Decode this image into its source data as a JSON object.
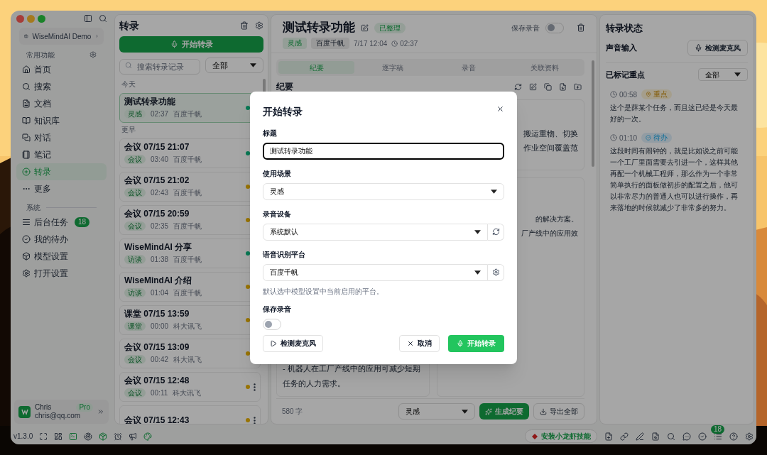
{
  "sidebar": {
    "workspace": "WiseMindAI Demo",
    "sections": [
      {
        "title": "常用功能",
        "items": [
          {
            "label": "首页",
            "selected": false
          },
          {
            "label": "搜索",
            "selected": false
          },
          {
            "label": "文档",
            "selected": false
          },
          {
            "label": "知识库",
            "selected": false
          },
          {
            "label": "对话",
            "selected": false
          },
          {
            "label": "笔记",
            "selected": false
          },
          {
            "label": "转录",
            "selected": true
          },
          {
            "label": "更多",
            "selected": false
          }
        ]
      },
      {
        "title": "系统",
        "items": [
          {
            "label": "后台任务",
            "badge": "18",
            "selected": false
          },
          {
            "label": "我的待办",
            "selected": false
          },
          {
            "label": "模型设置",
            "selected": false
          },
          {
            "label": "打开设置",
            "selected": false
          }
        ]
      }
    ],
    "user": {
      "name": "Chris",
      "badge": "Pro",
      "email": "chris@qq.com"
    }
  },
  "list_panel": {
    "title": "转录",
    "start_button": "开始转录",
    "search": {
      "placeholder": "搜索转录记录"
    },
    "filter": "全部",
    "groups": [
      {
        "title": "今天",
        "items": [
          {
            "title": "测试转录功能",
            "tag": "灵感",
            "duration": "02:37",
            "engine": "百度千帆",
            "color": "#0a7854",
            "selected": true
          }
        ]
      },
      {
        "title": "更早",
        "items": [
          {
            "title": "会议 07/15 21:07",
            "tag": "会议",
            "duration": "03:40",
            "engine": "百度千帆",
            "color": "#0a7854",
            "selected": false
          },
          {
            "title": "会议 07/15 21:02",
            "tag": "会议",
            "duration": "02:43",
            "engine": "百度千帆",
            "color": "#987405",
            "selected": false
          },
          {
            "title": "会议 07/15 20:59",
            "tag": "会议",
            "duration": "02:35",
            "engine": "百度千帆",
            "color": "#987405",
            "selected": false
          },
          {
            "title": "WiseMindAI 分享",
            "tag": "访谈",
            "duration": "01:38",
            "engine": "百度千帆",
            "color": "#0a7854",
            "selected": false
          },
          {
            "title": "WiseMindAI 介绍",
            "tag": "访谈",
            "duration": "01:04",
            "engine": "百度千帆",
            "color": "#987405",
            "selected": false
          },
          {
            "title": "课堂 07/15 13:59",
            "tag": "课堂",
            "duration": "00:00",
            "engine": "科大讯飞",
            "color": "#987405",
            "selected": false
          },
          {
            "title": "会议 07/15 13:09",
            "tag": "会议",
            "duration": "00:42",
            "engine": "科大讯飞",
            "color": "#987405",
            "selected": false
          },
          {
            "title": "会议 07/15 12:48",
            "tag": "会议",
            "duration": "00:11",
            "engine": "科大讯飞",
            "color": "#987405",
            "selected": false
          },
          {
            "title": "会议 07/15 12:43",
            "color": "#987405",
            "selected": false
          }
        ]
      }
    ]
  },
  "detail": {
    "title": "测试转录功能",
    "status_badge": "已整理",
    "tags": [
      {
        "kind": "scene",
        "label": "灵感"
      },
      {
        "kind": "engine",
        "label": "百度千帆"
      }
    ],
    "date": "7/17 12:04",
    "duration": "02:37",
    "save_recording": {
      "label": "保存录音",
      "on": false
    },
    "tabs": [
      {
        "label": "纪要",
        "selected": true
      },
      {
        "label": "逐字稿",
        "selected": false
      },
      {
        "label": "录音",
        "selected": false
      },
      {
        "label": "关联资料",
        "selected": false
      }
    ],
    "summary": {
      "title": "纪要",
      "top_card_lines": [
        "搬运重物、切换",
        "作业空间覆盖范"
      ],
      "right_card_lines": [
        "的解决方案。",
        "厂产线中的应用效"
      ],
      "left_card_lines": [
        "- 机器人在工厂产线中的应用可减少短期",
        "任务的人力需求。"
      ]
    },
    "word_count": "580 字",
    "scene_select": "灵感",
    "generate_button": "生成纪要",
    "export_button": "导出全部"
  },
  "right_panel": {
    "title": "转录状态",
    "voice_input": "声音输入",
    "mic_button": "检测麦克风",
    "marked_title": "已标记重点",
    "filter": "全部",
    "marks": [
      {
        "time": "00:58",
        "kind": "key",
        "label": "重点",
        "text": "这个是薛某个任务，而且这已经是今天最好的一次。"
      },
      {
        "time": "01:10",
        "kind": "todo",
        "label": "待办",
        "text": "这段时间有闹钟的，就是比如说之前可能一个工厂里面需要去引进一个，这样其他再配一个机械工程师，那么作为一个非常简单执行的面板做初步的配置之后，他可以非常尽力的普通人也可以进行操作，再来落地的时候就减少了非常多的努力。"
      }
    ]
  },
  "status_bar": {
    "version": "v1.3.0",
    "install_button": "安装小龙虾技能",
    "badge": "18"
  },
  "dialog": {
    "title": "开始转录",
    "fields": [
      {
        "kind": "text",
        "label": "标题",
        "value": "测试转录功能"
      },
      {
        "kind": "select",
        "label": "使用场景",
        "value": "灵感"
      },
      {
        "kind": "select_refresh",
        "label": "录音设备",
        "value": "系统默认"
      },
      {
        "kind": "select_settings",
        "label": "语音识别平台",
        "value": "百度千帆",
        "hint": "默认选中模型设置中当前启用的平台。"
      },
      {
        "kind": "toggle",
        "label": "保存录音",
        "on": false
      }
    ],
    "mic_button": "检测麦克风",
    "cancel_button": "取消",
    "start_button": "开始转录"
  }
}
